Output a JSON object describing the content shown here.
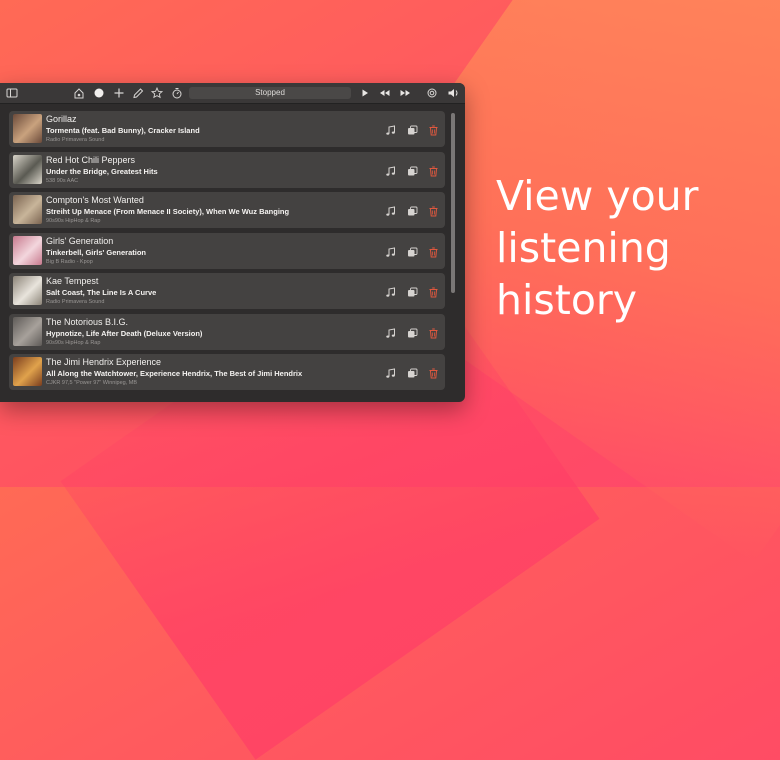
{
  "headline": [
    "View your",
    "listening",
    "history"
  ],
  "toolbar": {
    "status": "Stopped",
    "icons": [
      "sidebar-icon",
      "home-icon",
      "record-icon",
      "plus-icon",
      "pencil-icon",
      "star-icon",
      "timer-icon",
      "play-icon",
      "rewind-icon",
      "fast-forward-icon",
      "airplay-icon",
      "volume-icon"
    ]
  },
  "history": [
    {
      "artist": "Gorillaz",
      "track": "Tormenta (feat. Bad Bunny), Cracker Island",
      "station": "Radio Primavera Sound",
      "art_color": "#6b4a3a",
      "art_accent": "#c9a27e"
    },
    {
      "artist": "Red Hot Chili Peppers",
      "track": "Under the Bridge, Greatest Hits",
      "station": "538 90s AAC",
      "art_color": "#d9d4c9",
      "art_accent": "#5a5a52"
    },
    {
      "artist": "Compton's Most Wanted",
      "track": "Streiht Up Menace (From Menace II Society), When We Wuz Banging",
      "station": "90s90s HipHop & Rap",
      "art_color": "#7a6350",
      "art_accent": "#c8b59a"
    },
    {
      "artist": "Girls' Generation",
      "track": "Tinkerbell, Girls' Generation",
      "station": "Big B Radio - Kpop",
      "art_color": "#c7798d",
      "art_accent": "#f3d6dd"
    },
    {
      "artist": "Kae Tempest",
      "track": "Salt Coast, The Line Is A Curve",
      "station": "Radio Primavera Sound",
      "art_color": "#8c8478",
      "art_accent": "#e8e4dc"
    },
    {
      "artist": "The Notorious B.I.G.",
      "track": "Hypnotize, Life After Death (Deluxe Version)",
      "station": "90s90s HipHop & Rap",
      "art_color": "#5e5a57",
      "art_accent": "#a7a19b"
    },
    {
      "artist": "The Jimi Hendrix Experience",
      "track": "All Along the Watchtower, Experience Hendrix, The Best of Jimi Hendrix",
      "station": "CJKR 97,5 \"Power 97\" Winnipeg, MB",
      "art_color": "#7a3d1e",
      "art_accent": "#e0a24c"
    }
  ],
  "colors": {
    "delete": "#e0583e",
    "icon": "#d6d3d0"
  }
}
